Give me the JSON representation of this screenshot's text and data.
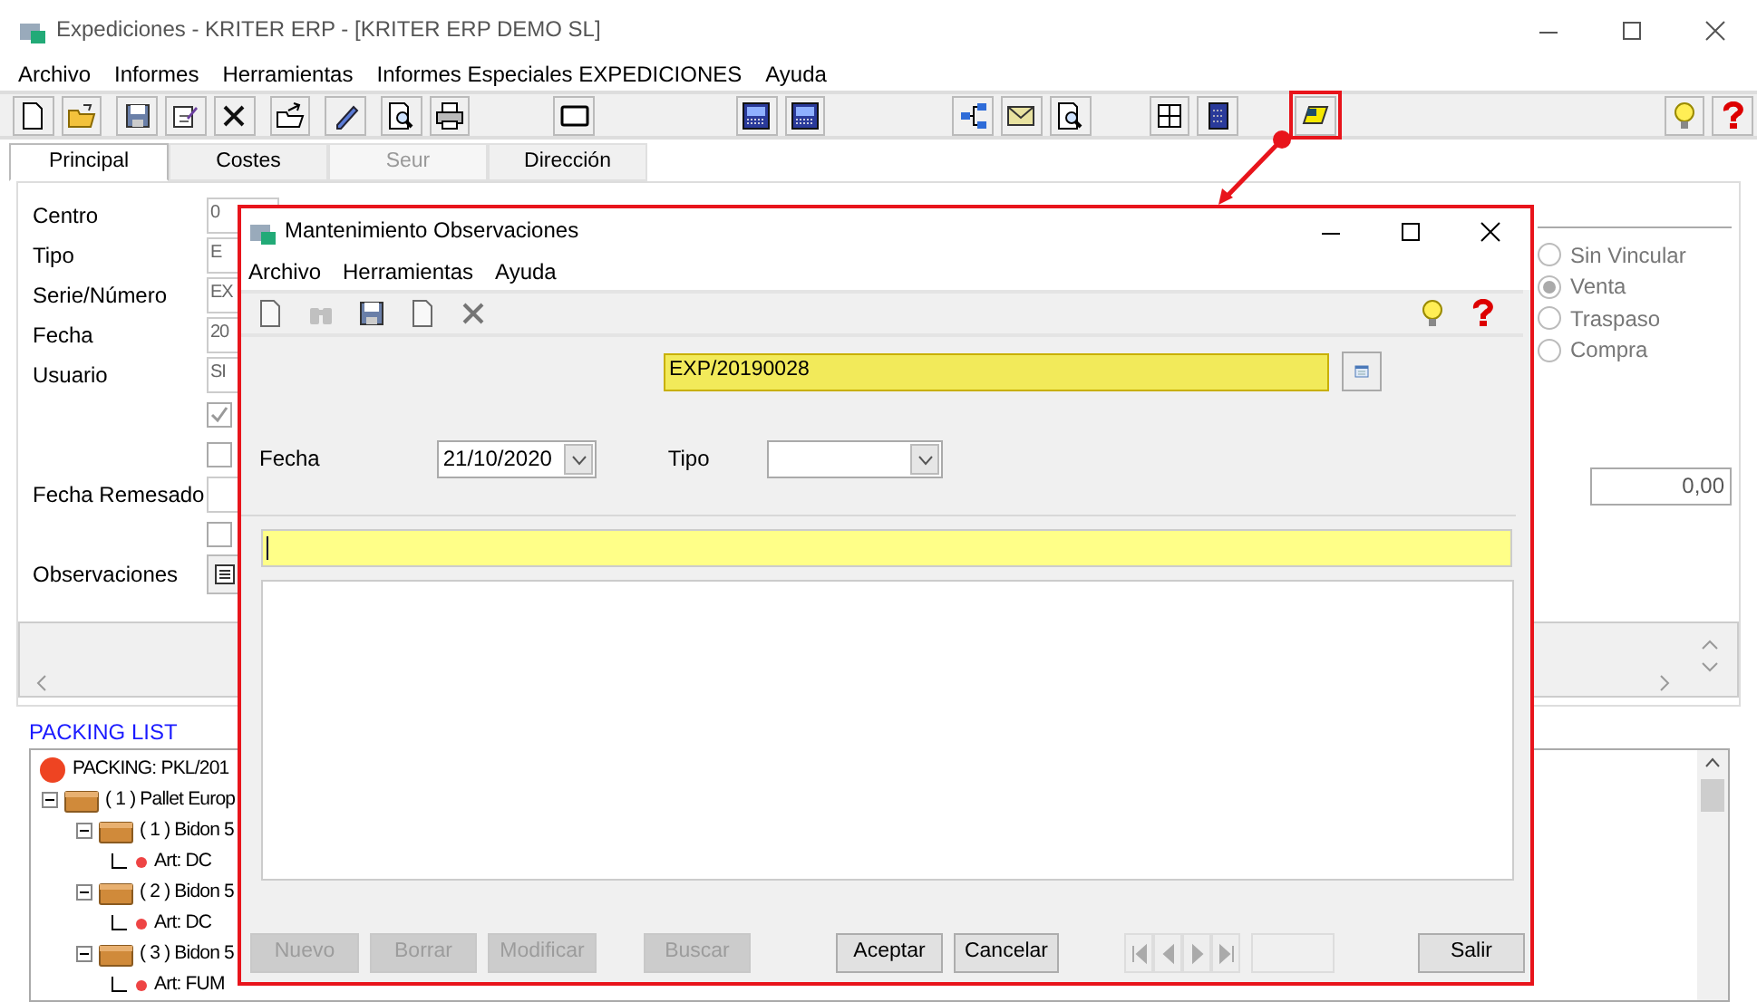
{
  "window": {
    "title": "Expediciones - KRITER ERP - [KRITER ERP DEMO SL]"
  },
  "menu": [
    "Archivo",
    "Informes",
    "Herramientas",
    "Informes Especiales EXPEDICIONES",
    "Ayuda"
  ],
  "toolbar": [
    {
      "kind": "new"
    },
    {
      "kind": "open"
    },
    {
      "kind": "save"
    },
    {
      "kind": "edit"
    },
    {
      "kind": "delete"
    },
    {
      "kind": "export"
    },
    {
      "kind": "pen"
    },
    {
      "kind": "preview"
    },
    {
      "kind": "print"
    },
    {
      "kind": "window"
    },
    {
      "kind": "terminal"
    },
    {
      "kind": "terminal"
    },
    {
      "kind": "tree"
    },
    {
      "kind": "mail"
    },
    {
      "kind": "preview"
    },
    {
      "kind": "grid"
    },
    {
      "kind": "calculator"
    },
    {
      "kind": "note"
    },
    {
      "kind": "bulb"
    },
    {
      "kind": "help"
    }
  ],
  "tabs": [
    {
      "label": "Principal",
      "selected": true,
      "disabled": false
    },
    {
      "label": "Costes",
      "selected": false,
      "disabled": false
    },
    {
      "label": "Seur",
      "selected": false,
      "disabled": true
    },
    {
      "label": "Dirección",
      "selected": false,
      "disabled": false
    }
  ],
  "form": [
    {
      "kind": "field",
      "label": "Centro",
      "value": "0"
    },
    {
      "kind": "field",
      "label": "Tipo",
      "value": "E"
    },
    {
      "kind": "field",
      "label": "Serie/Número",
      "value": "EX"
    },
    {
      "kind": "field",
      "label": "Fecha",
      "value": "20"
    },
    {
      "kind": "field",
      "label": "Usuario",
      "value": "SI"
    },
    {
      "kind": "checkbox",
      "checked": true
    },
    {
      "kind": "checkbox",
      "checked": false
    },
    {
      "kind": "field",
      "label": "Fecha Remesado"
    },
    {
      "kind": "checkbox",
      "checked": false
    },
    {
      "kind": "button",
      "label": "Observaciones"
    }
  ],
  "radios": [
    {
      "label": "Sin Vincular",
      "selected": false
    },
    {
      "label": "Venta",
      "selected": true
    },
    {
      "label": "Traspaso",
      "selected": false
    },
    {
      "label": "Compra",
      "selected": false
    }
  ],
  "amount": "0,00",
  "packing_list": {
    "title": "PACKING LIST",
    "tree": [
      {
        "kind": "root",
        "label": "PACKING: PKL/201",
        "children": [
          {
            "kind": "box",
            "label": "( 1 ) Pallet Europ",
            "expanded": true,
            "children": [
              {
                "kind": "box",
                "label": "( 1 ) Bidon 5",
                "expanded": true,
                "children": [
                  {
                    "kind": "article",
                    "label": "Art: DC"
                  }
                ]
              },
              {
                "kind": "box",
                "label": "( 2 ) Bidon 5",
                "expanded": true,
                "children": [
                  {
                    "kind": "article",
                    "label": "Art: DC"
                  }
                ]
              },
              {
                "kind": "box",
                "label": "( 3 ) Bidon 5",
                "expanded": true,
                "children": [
                  {
                    "kind": "article",
                    "label": "Art: FUM"
                  }
                ]
              }
            ]
          }
        ]
      }
    ]
  },
  "dialog": {
    "title": "Mantenimiento Observaciones",
    "menu": [
      "Archivo",
      "Herramientas",
      "Ayuda"
    ],
    "toolbar": [
      {
        "kind": "new",
        "disabled": true
      },
      {
        "kind": "binoculars",
        "disabled": true
      },
      {
        "kind": "save",
        "disabled": false
      },
      {
        "kind": "new",
        "disabled": true
      },
      {
        "kind": "delete",
        "disabled": true
      }
    ],
    "reference": "EXP/20190028",
    "fecha_label": "Fecha",
    "fecha": "21/10/2020",
    "tipo_label": "Tipo",
    "buttons": [
      {
        "kind": "action",
        "label": "Nuevo",
        "disabled": true
      },
      {
        "kind": "action",
        "label": "Borrar",
        "disabled": true
      },
      {
        "kind": "action",
        "label": "Modificar",
        "disabled": true
      },
      {
        "kind": "action",
        "label": "Buscar",
        "disabled": true
      },
      {
        "kind": "action",
        "label": "Aceptar",
        "disabled": false
      },
      {
        "kind": "action",
        "label": "Cancelar",
        "disabled": false
      },
      {
        "kind": "first",
        "disabled": true
      },
      {
        "kind": "prev",
        "disabled": true
      },
      {
        "kind": "next",
        "disabled": true
      },
      {
        "kind": "last",
        "disabled": true
      },
      {
        "kind": "counter"
      },
      {
        "kind": "action",
        "label": "Salir",
        "disabled": false
      }
    ]
  }
}
